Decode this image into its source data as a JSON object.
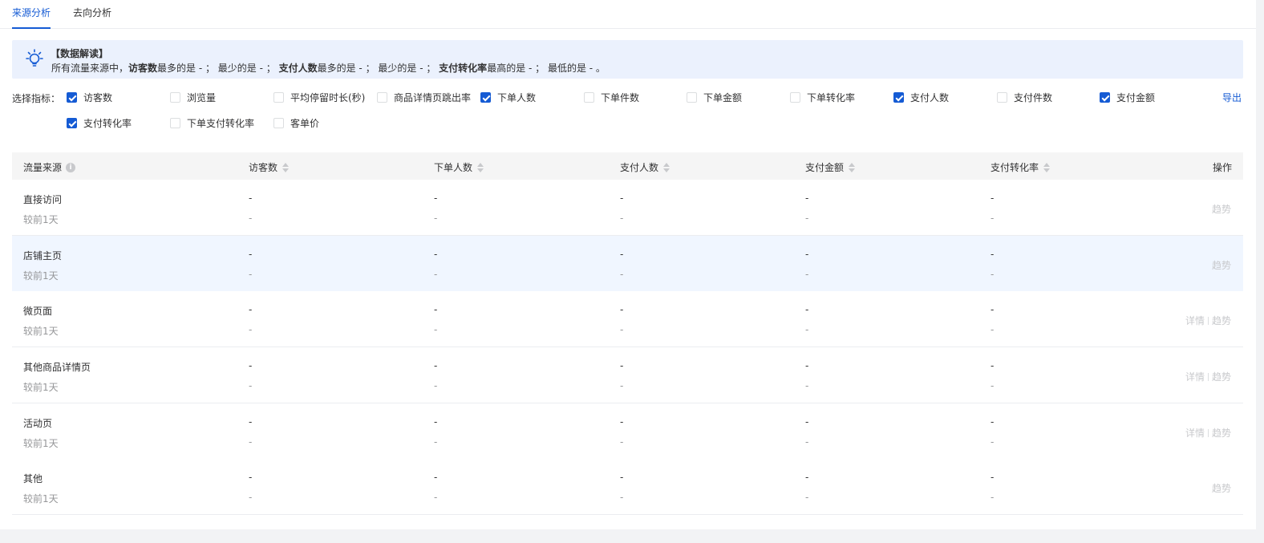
{
  "tabs": [
    {
      "label": "来源分析",
      "active": true
    },
    {
      "label": "去向分析",
      "active": false
    }
  ],
  "insight": {
    "title": "【数据解读】",
    "text": {
      "p1": "所有流量来源中，",
      "k1": "访客数",
      "p2": "最多的是 - ；  最少的是 - ；  ",
      "k2": "支付人数",
      "p3": "最多的是 - ；  最少的是 - ；  ",
      "k3": "支付转化率",
      "p4": "最高的是 - ；  最低的是 - 。"
    }
  },
  "metrics": {
    "label": "选择指标：",
    "export_label": "导出",
    "options": [
      {
        "label": "访客数",
        "checked": true
      },
      {
        "label": "浏览量",
        "checked": false
      },
      {
        "label": "平均停留时长(秒)",
        "checked": false
      },
      {
        "label": "商品详情页跳出率",
        "checked": false
      },
      {
        "label": "下单人数",
        "checked": true
      },
      {
        "label": "下单件数",
        "checked": false
      },
      {
        "label": "下单金额",
        "checked": false
      },
      {
        "label": "下单转化率",
        "checked": false
      },
      {
        "label": "支付人数",
        "checked": true
      },
      {
        "label": "支付件数",
        "checked": false
      },
      {
        "label": "支付金额",
        "checked": true
      },
      {
        "label": "支付转化率",
        "checked": true
      },
      {
        "label": "下单支付转化率",
        "checked": false
      },
      {
        "label": "客单价",
        "checked": false
      }
    ]
  },
  "table": {
    "columns": [
      "流量来源",
      "访客数",
      "下单人数",
      "支付人数",
      "支付金额",
      "支付转化率",
      "操作"
    ],
    "rows": [
      {
        "name": "直接访问",
        "compare": "较前1天",
        "values": [
          "-",
          "-",
          "-",
          "-",
          "-"
        ],
        "deltas": [
          "-",
          "-",
          "-",
          "-",
          "-"
        ],
        "actions": [
          "趋势"
        ]
      },
      {
        "name": "店铺主页",
        "compare": "较前1天",
        "values": [
          "-",
          "-",
          "-",
          "-",
          "-"
        ],
        "deltas": [
          "-",
          "-",
          "-",
          "-",
          "-"
        ],
        "actions": [
          "趋势"
        ]
      },
      {
        "name": "微页面",
        "compare": "较前1天",
        "values": [
          "-",
          "-",
          "-",
          "-",
          "-"
        ],
        "deltas": [
          "-",
          "-",
          "-",
          "-",
          "-"
        ],
        "actions": [
          "详情",
          "趋势"
        ]
      },
      {
        "name": "其他商品详情页",
        "compare": "较前1天",
        "values": [
          "-",
          "-",
          "-",
          "-",
          "-"
        ],
        "deltas": [
          "-",
          "-",
          "-",
          "-",
          "-"
        ],
        "actions": [
          "详情",
          "趋势"
        ]
      },
      {
        "name": "活动页",
        "compare": "较前1天",
        "values": [
          "-",
          "-",
          "-",
          "-",
          "-"
        ],
        "deltas": [
          "-",
          "-",
          "-",
          "-",
          "-"
        ],
        "actions": [
          "详情",
          "趋势"
        ]
      },
      {
        "name": "其他",
        "compare": "较前1天",
        "values": [
          "-",
          "-",
          "-",
          "-",
          "-"
        ],
        "deltas": [
          "-",
          "-",
          "-",
          "-",
          "-"
        ],
        "actions": [
          "趋势"
        ]
      }
    ]
  },
  "colors": {
    "accent": "#155bd4",
    "highlight_row": "#f0f6ff",
    "insight_bg": "#ebf1fd"
  }
}
